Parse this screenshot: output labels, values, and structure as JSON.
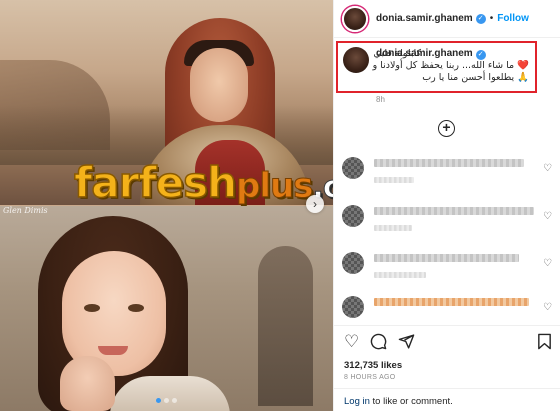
{
  "media": {
    "watermark_main": "farfesh",
    "watermark_plus": "plus",
    "watermark_com": ".com",
    "corner_mark": "Glen Dimis",
    "next_icon": "chevron-right-icon",
    "carousel": {
      "total": 3,
      "active_index": 0
    }
  },
  "header": {
    "username": "donia.samir.ghanem",
    "separator": "•",
    "follow_label": "Follow"
  },
  "caption": {
    "username": "donia.samir.ghanem",
    "line1": "كابلولة قلبي",
    "line2": "❤️ ما شاء الله... ربنا يحفظ كل أولادنا و",
    "line3": "🙏 يطلعوا أحسن منا يا رب",
    "time": "8h"
  },
  "comments": [
    {
      "blurred": true,
      "tone": "gray"
    },
    {
      "blurred": true,
      "tone": "gray"
    },
    {
      "blurred": true,
      "tone": "gray"
    },
    {
      "blurred": true,
      "tone": "warm"
    }
  ],
  "actions": {
    "like_icon": "heart-icon",
    "comment_icon": "comment-icon",
    "share_icon": "send-icon",
    "save_icon": "bookmark-icon"
  },
  "likes": "312,735 likes",
  "time_ago": "8 HOURS AGO",
  "login": {
    "link_label": "Log in",
    "rest": " to like or comment."
  },
  "colors": {
    "accent": "#0095f6",
    "highlight_border": "#e0232b",
    "watermark_gold": "#f4b21a",
    "watermark_orange": "#e07a12"
  }
}
